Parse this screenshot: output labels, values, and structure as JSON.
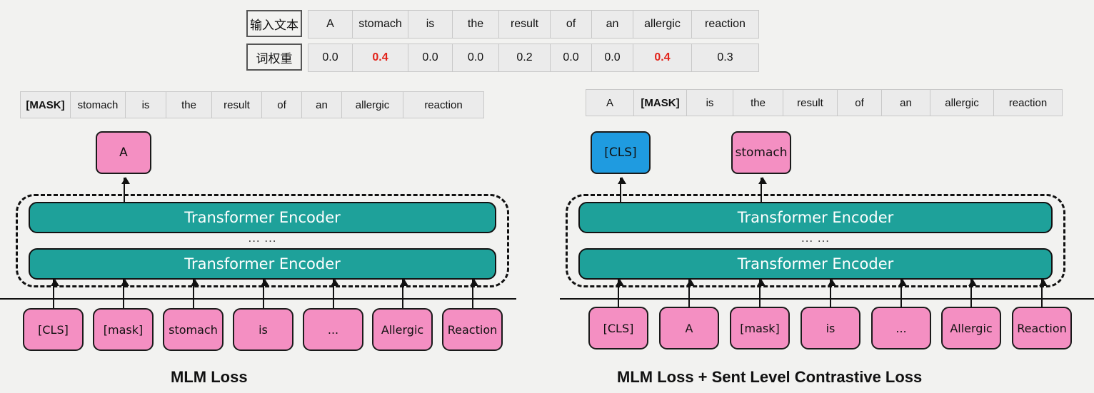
{
  "header": {
    "input_text_label": "输入文本",
    "weight_label": "词权重",
    "tokens": [
      "A",
      "stomach",
      "is",
      "the",
      "result",
      "of",
      "an",
      "allergic",
      "reaction"
    ],
    "weights": [
      "0.0",
      "0.4",
      "0.0",
      "0.0",
      "0.2",
      "0.0",
      "0.0",
      "0.4",
      "0.3"
    ],
    "highlighted_weight_indices": [
      1,
      7
    ],
    "highlight_color": "#e2231a"
  },
  "colors": {
    "background": "#f2f2f0",
    "encoder_teal": "#1ea19a",
    "token_pink": "#f48fc2",
    "cls_blue": "#1f9be0",
    "outline": "#1a1a1a",
    "cell_gray": "#ebebeb"
  },
  "left_panel": {
    "masked_sentence": [
      "[MASK]",
      "stomach",
      "is",
      "the",
      "result",
      "of",
      "an",
      "allergic",
      "reaction"
    ],
    "masked_index": 0,
    "outputs": [
      {
        "label": "A",
        "color": "pink"
      }
    ],
    "encoders": [
      {
        "label": "Transformer Encoder"
      },
      {
        "label": "Transformer Encoder"
      }
    ],
    "ellipsis": "... ...",
    "input_tokens": [
      "[CLS]",
      "[mask]",
      "stomach",
      "is",
      "...",
      "Allergic",
      "Reaction"
    ],
    "caption": "MLM  Loss"
  },
  "right_panel": {
    "masked_sentence": [
      "A",
      "[MASK]",
      "is",
      "the",
      "result",
      "of",
      "an",
      "allergic",
      "reaction"
    ],
    "masked_index": 1,
    "outputs": [
      {
        "label": "[CLS]",
        "color": "blue"
      },
      {
        "label": "stomach",
        "color": "pink"
      }
    ],
    "encoders": [
      {
        "label": "Transformer Encoder"
      },
      {
        "label": "Transformer Encoder"
      }
    ],
    "ellipsis": "... ...",
    "input_tokens": [
      "[CLS]",
      "A",
      "[mask]",
      "is",
      "...",
      "Allergic",
      "Reaction"
    ],
    "caption": "MLM  Loss + Sent Level Contrastive Loss"
  }
}
